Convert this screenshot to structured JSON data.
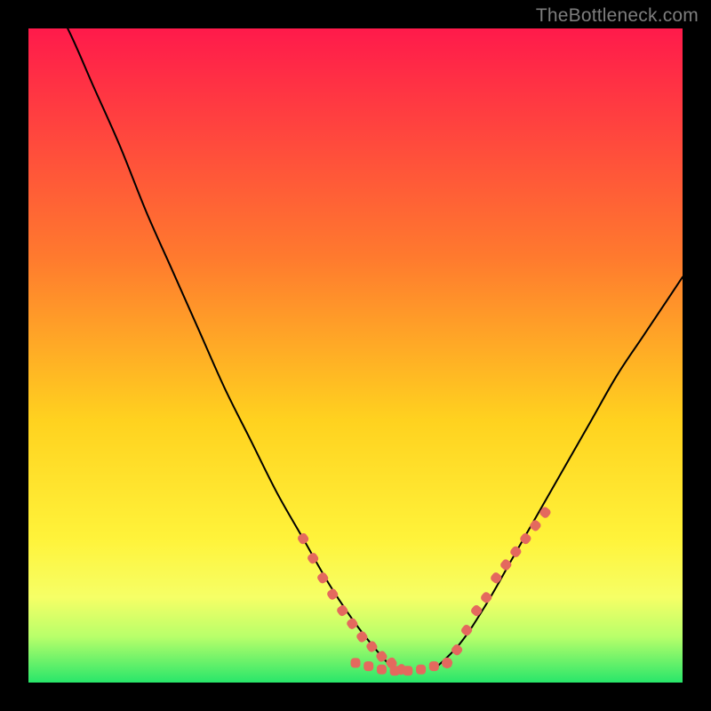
{
  "branding": {
    "watermark": "TheBottleneck.com"
  },
  "chart_data": {
    "type": "line",
    "title": "",
    "xlabel": "",
    "ylabel": "",
    "xlim": [
      0,
      100
    ],
    "ylim": [
      0,
      100
    ],
    "grid": false,
    "background_gradient": {
      "stops": [
        {
          "offset": 0,
          "color": "#ff1a4b"
        },
        {
          "offset": 35,
          "color": "#ff7a2e"
        },
        {
          "offset": 60,
          "color": "#ffd21f"
        },
        {
          "offset": 78,
          "color": "#fff33a"
        },
        {
          "offset": 87,
          "color": "#f6ff66"
        },
        {
          "offset": 93,
          "color": "#b8ff6a"
        },
        {
          "offset": 100,
          "color": "#28e66a"
        }
      ]
    },
    "series": [
      {
        "name": "bottleneck-curve-left",
        "color": "#000000",
        "x": [
          2,
          6,
          10,
          14,
          18,
          22,
          26,
          30,
          34,
          38,
          42,
          46,
          50,
          54,
          56
        ],
        "y": [
          107,
          100,
          91,
          82,
          72,
          63,
          54,
          45,
          37,
          29,
          22,
          15,
          9,
          4,
          2
        ]
      },
      {
        "name": "bottleneck-curve-right",
        "color": "#000000",
        "x": [
          62,
          66,
          70,
          74,
          78,
          82,
          86,
          90,
          94,
          98,
          100
        ],
        "y": [
          2,
          6,
          12,
          19,
          26,
          33,
          40,
          47,
          53,
          59,
          62
        ]
      },
      {
        "name": "highlight-dots-left",
        "color": "#e4695e",
        "x": [
          42,
          43.5,
          45,
          46.5,
          48,
          49.5,
          51,
          52.5,
          54,
          55.5,
          57
        ],
        "y": [
          22,
          19,
          16,
          13.5,
          11,
          9,
          7,
          5.5,
          4,
          3,
          2
        ]
      },
      {
        "name": "highlight-dots-bottom",
        "color": "#e4695e",
        "x": [
          50,
          52,
          54,
          56,
          58,
          60,
          62,
          64
        ],
        "y": [
          3,
          2.5,
          2,
          1.8,
          1.8,
          2,
          2.5,
          3
        ]
      },
      {
        "name": "highlight-dots-right",
        "color": "#e4695e",
        "x": [
          64,
          65.5,
          67,
          68.5,
          70,
          71.5,
          73,
          74.5,
          76,
          77.5,
          79
        ],
        "y": [
          3,
          5,
          8,
          11,
          13,
          16,
          18,
          20,
          22,
          24,
          26
        ]
      }
    ]
  }
}
